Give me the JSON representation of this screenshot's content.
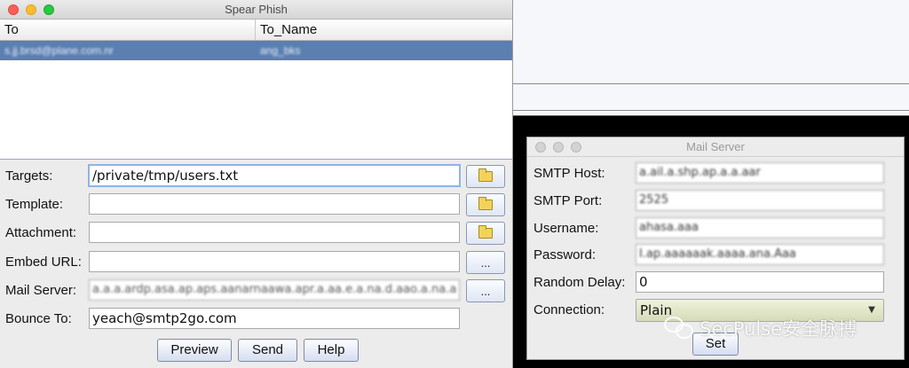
{
  "main_window": {
    "title": "Spear Phish",
    "table": {
      "columns": [
        "To",
        "To_Name"
      ],
      "rows": [
        {
          "to": "s.jj.brsd@plane.com.nr",
          "to_name": "ang_bks"
        }
      ]
    },
    "form": {
      "targets": {
        "label": "Targets:",
        "value": "/private/tmp/users.txt"
      },
      "template": {
        "label": "Template:",
        "value": ""
      },
      "attachment": {
        "label": "Attachment:",
        "value": ""
      },
      "embed_url": {
        "label": "Embed URL:",
        "value": "",
        "button": "..."
      },
      "mail_server": {
        "label": "Mail Server:",
        "value": "a.a.a.ardp.asa.ap.aps.aanarnaawa.apr.a.aa.e.a.na.d.aao.a.na.a",
        "button": "..."
      },
      "bounce_to": {
        "label": "Bounce To:",
        "value": "yeach@smtp2go.com"
      }
    },
    "buttons": {
      "preview": "Preview",
      "send": "Send",
      "help": "Help"
    }
  },
  "mail_window": {
    "title": "Mail Server",
    "smtp_host": {
      "label": "SMTP Host:",
      "value": "a.ail.a.shp.ap.a.a.aar"
    },
    "smtp_port": {
      "label": "SMTP Port:",
      "value": "2525"
    },
    "username": {
      "label": "Username:",
      "value": "ahasa.aaa"
    },
    "password": {
      "label": "Password:",
      "value": "I.ap.aaaaaak.aaaa.ana.Aaa"
    },
    "random_delay": {
      "label": "Random Delay:",
      "value": "0"
    },
    "connection": {
      "label": "Connection:",
      "value": "Plain"
    },
    "set_button": "Set"
  },
  "watermark": {
    "text": "SecPulse安全脉搏"
  },
  "icons": {
    "folder": "folder-icon",
    "ellipsis": "ellipsis-button",
    "dropdown": "chevron-down-icon"
  }
}
